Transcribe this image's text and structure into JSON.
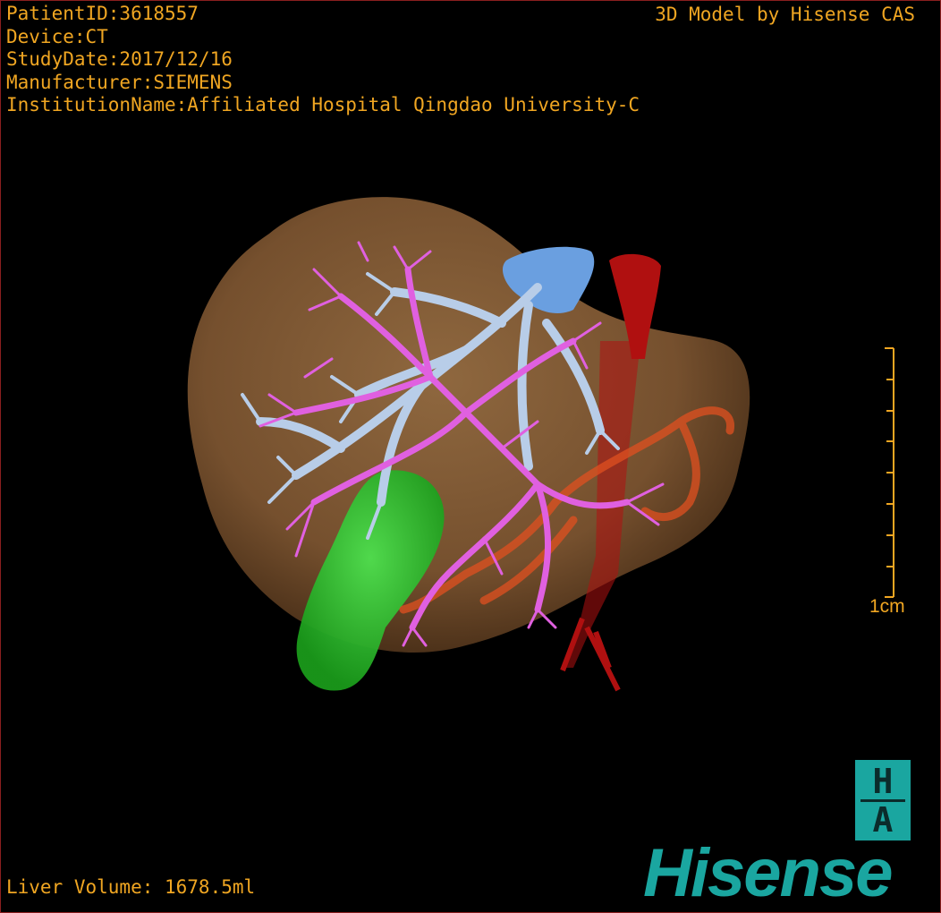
{
  "overlay": {
    "patient_id": "PatientID:3618557",
    "device": "Device:CT",
    "study_date": "StudyDate:2017/12/16",
    "manufacturer": "Manufacturer:SIEMENS",
    "institution": "InstitutionName:Affiliated Hospital Qingdao University-C",
    "credit": "3D Model by Hisense CAS",
    "liver_volume": "Liver Volume: 1678.5ml"
  },
  "scale_bar": {
    "label": "1cm"
  },
  "logo": {
    "badge_top": "H",
    "badge_bottom": "A",
    "brand": "Hisense"
  },
  "colors": {
    "text": "#f0a622",
    "liver": "#9a6a3e",
    "hepatic_vein": "#e060e0",
    "portal_vein": "#b8cde8",
    "vena_cava": "#6a9fe0",
    "aorta": "#b01010",
    "artery": "#e05020",
    "gallbladder": "#32c832",
    "brand": "#1aa6a0"
  }
}
